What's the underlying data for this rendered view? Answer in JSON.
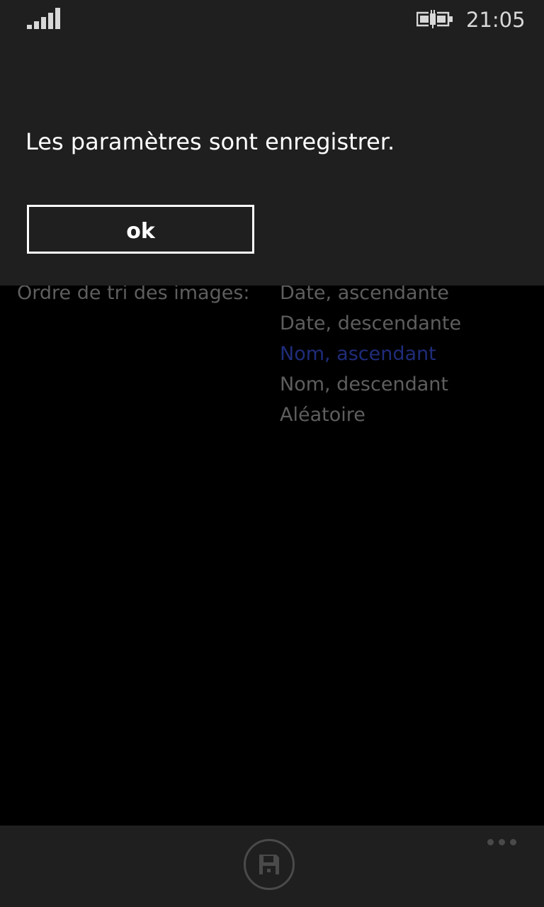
{
  "status_bar": {
    "time": "21:05",
    "signal_icon": "signal-strength-icon",
    "battery_icon": "battery-charging-icon"
  },
  "dialog": {
    "message": "Les paramètres sont enregistrer.",
    "ok_label": "ok"
  },
  "settings": {
    "sort_label": "Ordre de tri des images:",
    "sort_options": [
      {
        "label": "Date, ascendante",
        "selected": false
      },
      {
        "label": "Date, descendante",
        "selected": false
      },
      {
        "label": "Nom, ascendant",
        "selected": true
      },
      {
        "label": "Nom, descendant",
        "selected": false
      },
      {
        "label": "Aléatoire",
        "selected": false
      }
    ]
  },
  "app_bar": {
    "save_icon": "save-icon",
    "more_icon": "more-ellipsis-icon"
  },
  "colors": {
    "dialog_background": "#1f1f1f",
    "dimmed_text": "#5e5e5e",
    "selected_accent_dimmed": "#1f2c7a"
  }
}
